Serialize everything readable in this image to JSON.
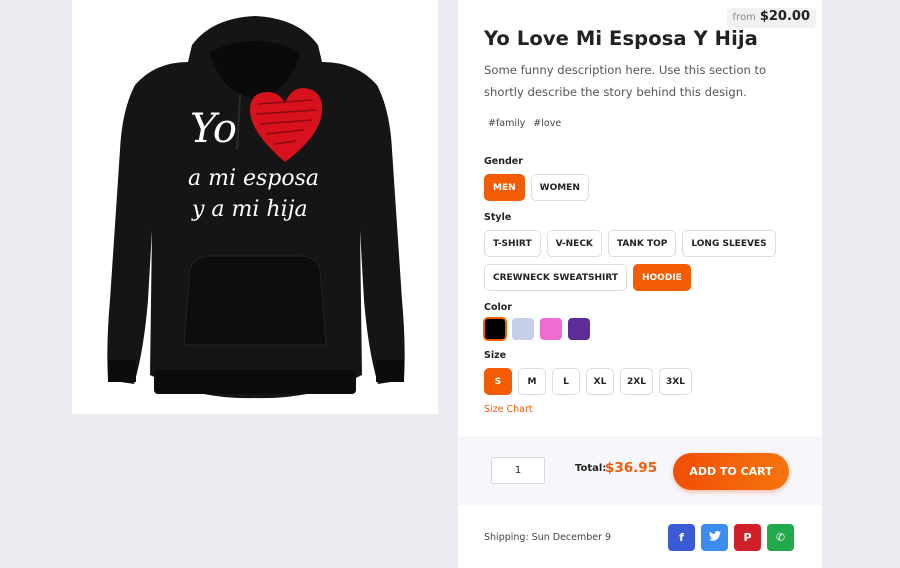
{
  "product": {
    "price_from_label": "from",
    "price_from_value": "$20.00",
    "title": "Yo Love Mi Esposa Y Hija",
    "description": "Some funny description here. Use this section to shortly describe the story behind this design.",
    "tags": [
      "#family",
      "#love"
    ],
    "artwork_text": {
      "line1": "Yo",
      "line2": "a mi esposa",
      "line3": "y a mi hija"
    }
  },
  "options": {
    "gender": {
      "label": "Gender",
      "items": [
        "MEN",
        "WOMEN"
      ],
      "selected": "MEN"
    },
    "style": {
      "label": "Style",
      "items": [
        "T-SHIRT",
        "V-NECK",
        "TANK TOP",
        "LONG SLEEVES",
        "CREWNECK SWEATSHIRT",
        "HOODIE"
      ],
      "selected": "HOODIE"
    },
    "color": {
      "label": "Color",
      "swatches": [
        "#000000",
        "#c6cfe8",
        "#f06bd2",
        "#5b2c9a"
      ],
      "selected": "#000000"
    },
    "size": {
      "label": "Size",
      "items": [
        "S",
        "M",
        "L",
        "XL",
        "2XL",
        "3XL"
      ],
      "selected": "S"
    },
    "size_chart_link": "Size Chart"
  },
  "cart": {
    "quantity": "1",
    "total_label": "Total:",
    "total_value": "$36.95",
    "add_to_cart": "ADD TO CART"
  },
  "shipping": {
    "text": "Shipping: Sun December 9"
  },
  "share": [
    {
      "icon": "facebook-icon",
      "glyph": "f",
      "color": "#3b5bd6"
    },
    {
      "icon": "twitter-icon",
      "glyph": "🐦",
      "color": "#3d8cf0"
    },
    {
      "icon": "pinterest-icon",
      "glyph": "P",
      "color": "#d0202a"
    },
    {
      "icon": "whatsapp-icon",
      "glyph": "✆",
      "color": "#22a94b"
    }
  ],
  "colors": {
    "accent": "#f25c05",
    "page_background": "#ebebf1"
  }
}
